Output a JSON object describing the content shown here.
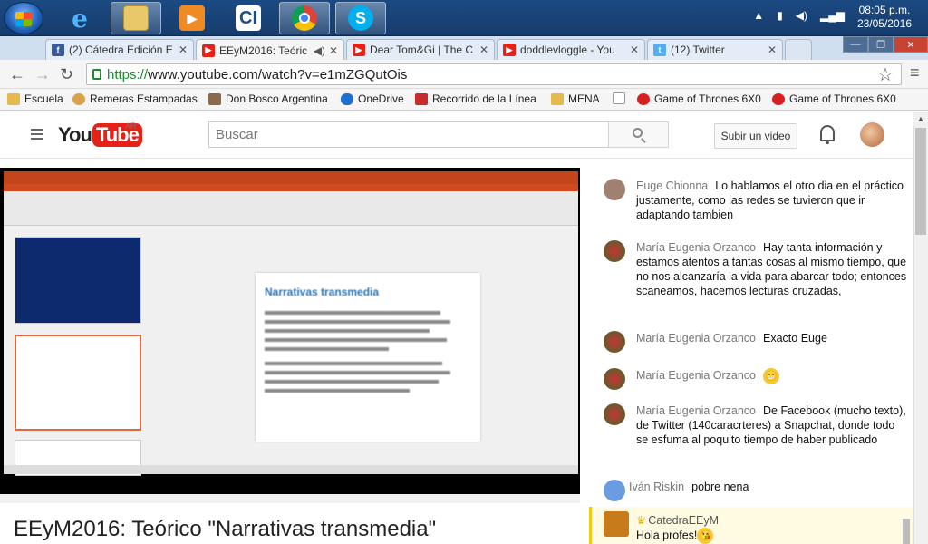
{
  "taskbar": {
    "apps": [
      {
        "name": "Windows Explorer",
        "icon": "folder-icon"
      },
      {
        "name": "Internet Explorer",
        "icon": "ie-icon"
      },
      {
        "name": "Media Player",
        "icon": "media-icon"
      },
      {
        "name": "CI",
        "icon": "ci-icon"
      },
      {
        "name": "Google Chrome",
        "icon": "chrome-icon"
      },
      {
        "name": "Skype",
        "icon": "skype-icon"
      }
    ],
    "clock_time": "08:05 p.m.",
    "clock_date": "23/05/2016"
  },
  "tabs": [
    {
      "title": "(2) Cátedra Edición E",
      "favicon": "facebook-icon",
      "active": false
    },
    {
      "title": "EEyM2016: Teóric",
      "favicon": "youtube-icon",
      "active": true
    },
    {
      "title": "Dear Tom&Gi | The C",
      "favicon": "youtube-icon",
      "active": false
    },
    {
      "title": "doddlevloggle - You",
      "favicon": "youtube-icon",
      "active": false
    },
    {
      "title": "(12) Twitter",
      "favicon": "twitter-icon",
      "active": false
    }
  ],
  "address": {
    "https": "https://",
    "rest": "www.youtube.com/watch?v=e1mZGQutOis"
  },
  "bookmarks": [
    "Escuela",
    "Remeras Estampadas",
    "Don Bosco Argentina",
    "OneDrive",
    "Recorrido de la Línea",
    "MENA",
    "",
    "Game of Thrones 6X0",
    "Game of Thrones 6X0"
  ],
  "youtube": {
    "logo_you": "You",
    "logo_tube": "Tube",
    "region": "AR",
    "search_placeholder": "Buscar",
    "upload_label": "Subir un video"
  },
  "video": {
    "title": "EEyM2016: Teórico \"Narrativas transmedia\"",
    "slide_title": "Narrativas transmedia"
  },
  "chat": [
    {
      "author": "Euge Chionna",
      "text": "Lo hablamos el otro dia en el práctico justamente, como las redes se tuvieron que ir adaptando tambien",
      "avatar_color": "#a08070"
    },
    {
      "author": "María Eugenia Orzanco",
      "text": "Hay tanta información y estamos atentos a tantas cosas al mismo tiempo, que no nos alcanzaría la vida para abarcar todo; entonces scaneamos, hacemos lecturas cruzadas,",
      "avatar_color": "#3a6b2a"
    },
    {
      "author": "María Eugenia Orzanco",
      "text": "Exacto Euge",
      "avatar_color": "#3a6b2a"
    },
    {
      "author": "María Eugenia Orzanco",
      "text": "",
      "emoji": "😁",
      "avatar_color": "#3a6b2a"
    },
    {
      "author": "María Eugenia Orzanco",
      "text": "De Facebook (mucho texto), de Twitter (140caracrteres) a Snapchat, donde todo se esfuma al poquito tiempo de haber publicado",
      "avatar_color": "#3a6b2a"
    },
    {
      "author": "Iván Riskin",
      "text": "pobre nena",
      "avatar_color": "#6b9be0"
    },
    {
      "author": "CatedraEEyM",
      "text": "Hola profes!",
      "emoji": "😘",
      "avatar_color": "#c77b1a",
      "owner": true
    }
  ]
}
